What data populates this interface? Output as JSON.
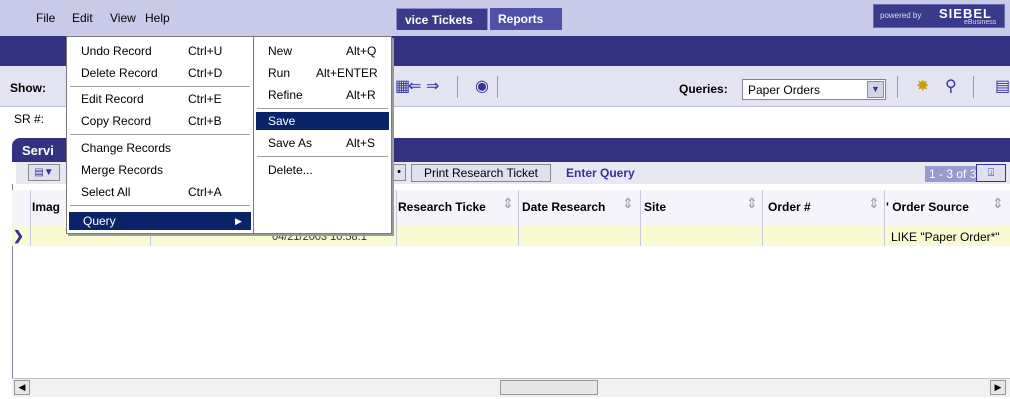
{
  "menubar": {
    "items": [
      "File",
      "Edit",
      "View",
      "Help"
    ],
    "logo": {
      "powered": "powered by",
      "brand": "SIEBEL",
      "sub": "eBusiness"
    }
  },
  "tabs": [
    {
      "label": "vice Tickets",
      "active": true
    },
    {
      "label": "Reports",
      "active": false
    }
  ],
  "toolbar": {
    "show_label": "Show:",
    "queries_label": "Queries:",
    "query_selected": "Paper Orders"
  },
  "sr_label": "SR #:",
  "applet": {
    "title": "Servi",
    "print_button": "Print Research Ticket",
    "enter_query": "Enter Query",
    "paging": "1 - 3 of 3",
    "columns": [
      {
        "label": "Imag"
      },
      {
        "label": "Research Ticke"
      },
      {
        "label": "Date Research"
      },
      {
        "label": "Site"
      },
      {
        "label": "Order #"
      },
      {
        "label": "' Order Source"
      }
    ],
    "row": {
      "date": "04/21/2003 10:58:1",
      "order_source": "LIKE \"Paper Order*\""
    }
  },
  "edit_menu": {
    "items": [
      {
        "label": "Undo Record",
        "shortcut": "Ctrl+U"
      },
      {
        "label": "Delete Record",
        "shortcut": "Ctrl+D"
      },
      {
        "label": "Edit Record",
        "shortcut": "Ctrl+E"
      },
      {
        "label": "Copy Record",
        "shortcut": "Ctrl+B"
      },
      {
        "label": "Change Records",
        "shortcut": ""
      },
      {
        "label": "Merge Records",
        "shortcut": ""
      },
      {
        "label": "Select All",
        "shortcut": "Ctrl+A"
      },
      {
        "label": "Query",
        "shortcut": ""
      }
    ]
  },
  "query_menu": {
    "items": [
      {
        "label": "New",
        "shortcut": "Alt+Q"
      },
      {
        "label": "Run",
        "shortcut": "Alt+ENTER"
      },
      {
        "label": "Refine",
        "shortcut": "Alt+R"
      },
      {
        "label": "Save",
        "shortcut": ""
      },
      {
        "label": "Save As",
        "shortcut": "Alt+S"
      },
      {
        "label": "Delete...",
        "shortcut": ""
      }
    ]
  },
  "colors": {
    "accent": "#323280",
    "highlight": "#0a246a",
    "row_bg": "#fafad2"
  }
}
